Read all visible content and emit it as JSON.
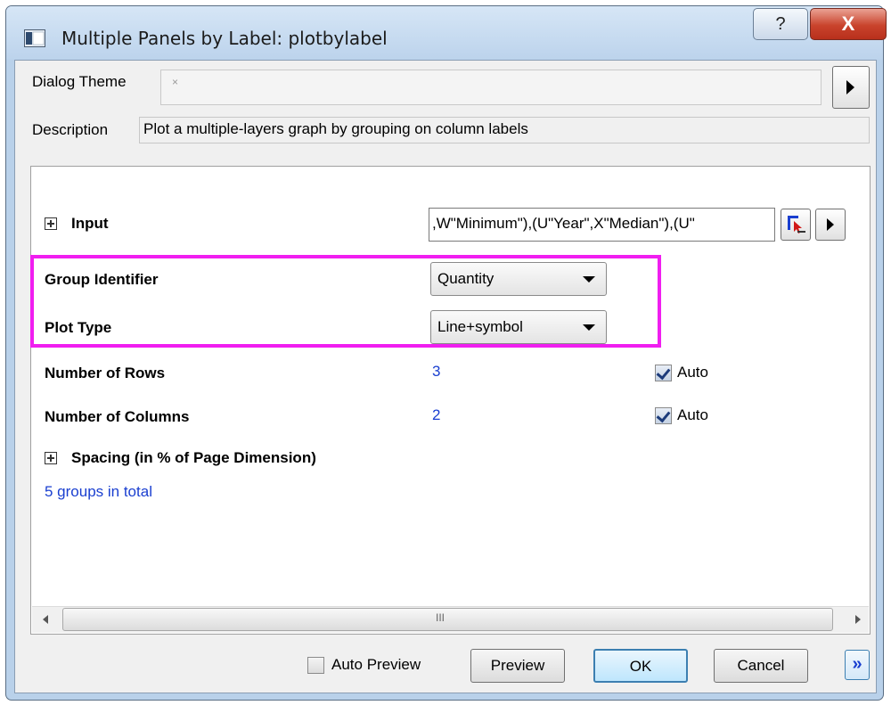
{
  "window": {
    "title": "Multiple Panels by Label: plotbylabel",
    "help_glyph": "?",
    "close_glyph": "X"
  },
  "dialog_theme": {
    "label": "Dialog Theme",
    "value": "×"
  },
  "description": {
    "label": "Description",
    "value": "Plot a multiple-layers graph by grouping on column labels"
  },
  "params": {
    "input_label": "Input",
    "input_value": ",W\"Minimum\"),(U\"Year\",X\"Median\"),(U\"",
    "group_identifier_label": "Group Identifier",
    "group_identifier_value": "Quantity",
    "plot_type_label": "Plot Type",
    "plot_type_value": "Line+symbol",
    "rows_label": "Number of Rows",
    "rows_value": "3",
    "rows_auto_label": "Auto",
    "rows_auto_checked": true,
    "columns_label": "Number of Columns",
    "columns_value": "2",
    "columns_auto_label": "Auto",
    "columns_auto_checked": true,
    "spacing_label": "Spacing (in % of Page Dimension)",
    "groups_info": "5 groups in total"
  },
  "scrollbar": {
    "grip": "III"
  },
  "footer": {
    "auto_preview_label": "Auto Preview",
    "auto_preview_checked": false,
    "preview_label": "Preview",
    "ok_label": "OK",
    "cancel_label": "Cancel",
    "more_glyph": "»"
  },
  "colors": {
    "highlight_box": "#f01ef0",
    "value_text": "#1a3fd0",
    "close_button": "#c9432c"
  }
}
